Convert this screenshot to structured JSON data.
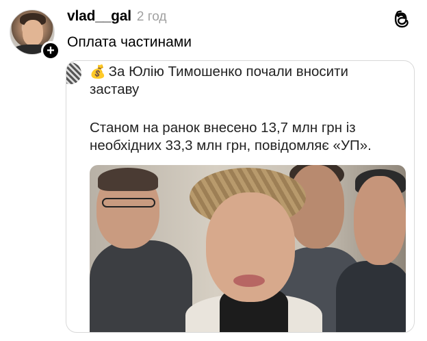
{
  "post": {
    "username": "vlad__gal",
    "time": "2 год",
    "text": "Оплата частинами"
  },
  "quote": {
    "emoji": "💰",
    "line1": "За Юлію Тимошенко почали вносити",
    "line2": "заставу",
    "line3": "Станом на ранок внесено 13,7 млн грн із",
    "line4": "необхідних 33,3 млн грн, повідомляє «УП»."
  },
  "icons": {
    "app": "threads-icon",
    "follow": "plus-icon"
  },
  "colors": {
    "text": "#000000",
    "muted": "#a0a0a0",
    "border": "#d8d8d8"
  }
}
